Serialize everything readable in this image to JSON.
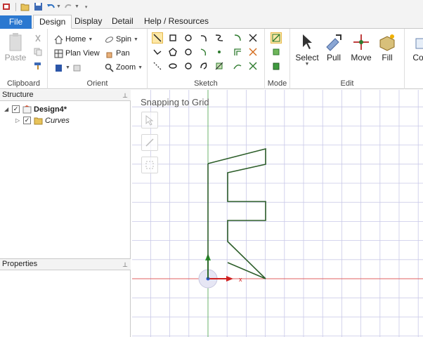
{
  "window": {
    "title_bar_visible": false
  },
  "quick_access": {
    "items": [
      "app-icon",
      "open-icon",
      "save-icon",
      "undo-icon",
      "redo-icon",
      "customize-icon"
    ]
  },
  "tabs": {
    "file": "File",
    "design": "Design",
    "display": "Display",
    "detail": "Detail",
    "help": "Help / Resources"
  },
  "ribbon": {
    "clipboard": {
      "label": "Clipboard",
      "paste": "Paste"
    },
    "orient": {
      "label": "Orient",
      "home": "Home",
      "plan_view": "Plan View",
      "spin": "Spin",
      "pan": "Pan",
      "zoom": "Zoom"
    },
    "sketch": {
      "label": "Sketch"
    },
    "mode": {
      "label": "Mode"
    },
    "edit": {
      "label": "Edit",
      "select": "Select",
      "pull": "Pull",
      "move": "Move",
      "fill": "Fill"
    },
    "intersect": {
      "label_partial": "Com"
    }
  },
  "structure": {
    "title": "Structure",
    "root": "Design4*",
    "child": "Curves"
  },
  "properties": {
    "title": "Properties"
  },
  "viewport": {
    "hint": "Snapping to Grid",
    "axis_x": "x"
  },
  "colors": {
    "accent": "#2b78d0",
    "sketch_line": "#2d5e2a",
    "grid": "#c9c9e8",
    "axis_x": "#e06060",
    "axis_y": "#60b060"
  }
}
